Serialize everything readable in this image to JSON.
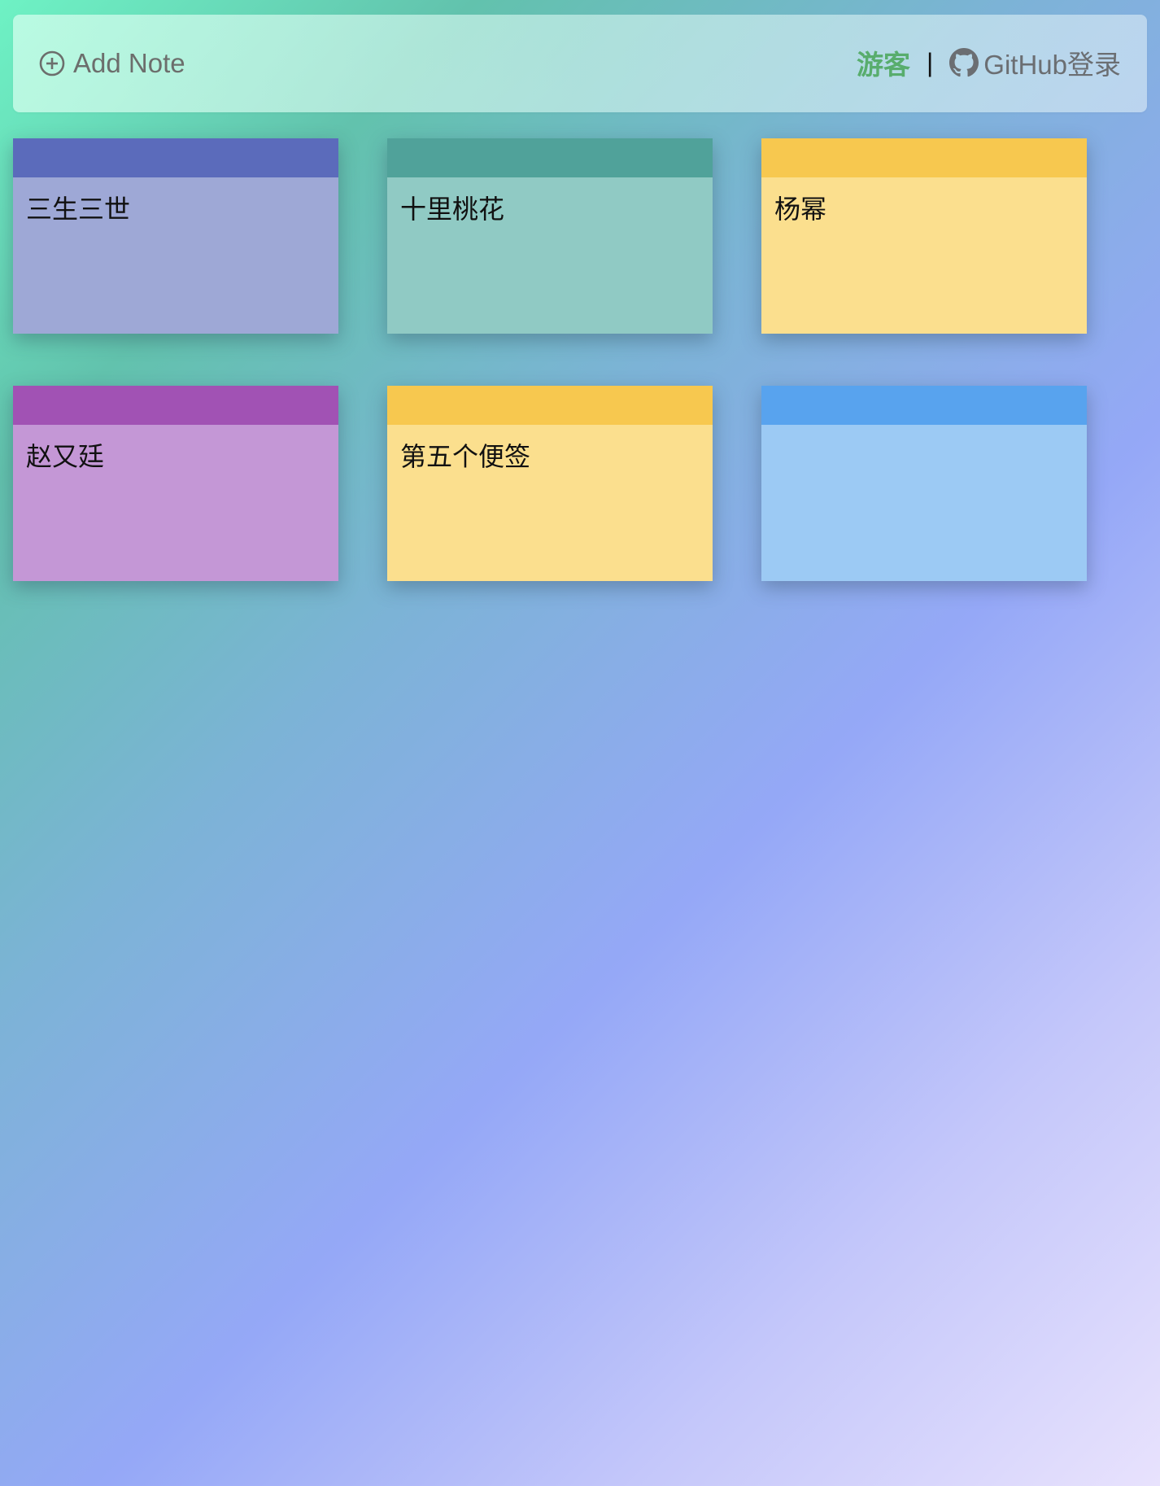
{
  "header": {
    "add_note_label": "Add Note",
    "guest_label": "游客",
    "separator": "|",
    "github_login_label": "GitHub登录",
    "guest_color": "#58ad6d"
  },
  "notes": [
    {
      "text": "三生三世",
      "header_color": "#5b6bbb",
      "body_color": "#9ea8d6"
    },
    {
      "text": "十里桃花",
      "header_color": "#50a29a",
      "body_color": "#90cac4"
    },
    {
      "text": "杨幂",
      "header_color": "#f7c84f",
      "body_color": "#fbdf8e"
    },
    {
      "text": "赵又廷",
      "header_color": "#a152b4",
      "body_color": "#c497d6"
    },
    {
      "text": "第五个便签",
      "header_color": "#f7c84f",
      "body_color": "#fbdf8e"
    },
    {
      "text": "",
      "header_color": "#58a3ee",
      "body_color": "#9ccaf4"
    }
  ]
}
